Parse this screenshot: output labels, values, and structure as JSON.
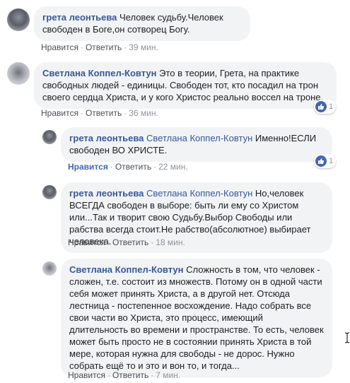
{
  "comments": [
    {
      "author": "грета леонтьева",
      "mention": "",
      "text": "Человек судьбу.Человек свободен в Боге,он сотворец Богу.",
      "like_label": "Нравится",
      "reply_label": "Ответить",
      "time": "39 мин.",
      "reactions": ""
    },
    {
      "author": "Светлана Коппел-Ковтун",
      "mention": "",
      "text": "Это в теории, Грета, на практике свободных людей - единицы. Свободен тот, кто посадил на трон своего сердца Христа, и у кого Христос реально воссел на троне.",
      "like_label": "Нравится",
      "reply_label": "Ответить",
      "time": "36 мин.",
      "reactions": "1"
    },
    {
      "author": "грета леонтьева",
      "mention": "Светлана Коппел-Ковтун",
      "text": "Именно!ЕСЛИ свободен ВО ХРИСТЕ.",
      "like_label": "Нравится",
      "reply_label": "Ответить",
      "time": "22 мин.",
      "reactions": "1"
    },
    {
      "author": "грета леонтьева",
      "mention": "Светлана Коппел-Ковтун",
      "text": "Но,человек ВСЕГДА свободен в выборе: быть ли ему со Христом или...Так и творит свою Судьбу.Выбор Свободы или рабства всегда стоит.Не рабство(абсолютное) выбирает человека.",
      "like_label": "Нравится",
      "reply_label": "Ответить",
      "time": "18 мин.",
      "reactions": ""
    },
    {
      "author": "Светлана Коппел-Ковтун",
      "mention": "",
      "text": "Сложность в том, что человек - сложен, т.е. состоит из множеств. Потому он в одной части себя может принять Христа, а в другой нет. Отсюда лестница - постепенное восхождение. Надо собрать все свои части во Христа, это процесс, имеющий длительность во времени и пространстве. То есть, человек может быть просто не в состоянии принять Христа в той мере, которая нужна для свободы - не дорос. Нужно собрать ещё то и это и вон то, и тогда...",
      "like_label": "Нравится",
      "reply_label": "Ответить",
      "time": "7 мин.",
      "reactions": ""
    }
  ]
}
